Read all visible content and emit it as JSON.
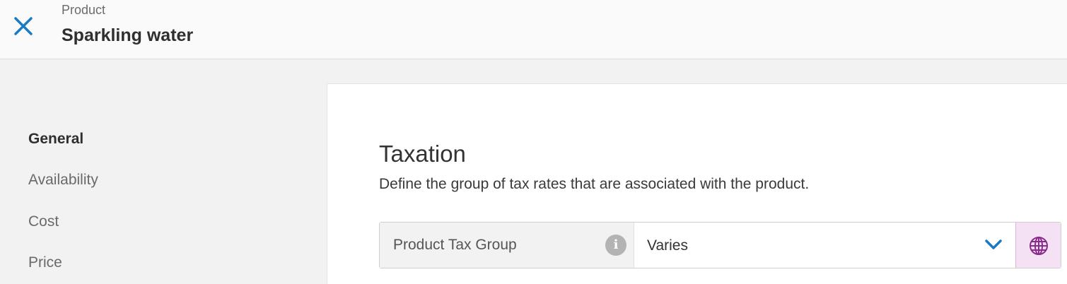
{
  "header": {
    "breadcrumb": "Product",
    "title": "Sparkling water",
    "close_icon": "close-icon"
  },
  "sidebar": {
    "items": [
      {
        "label": "General",
        "active": true
      },
      {
        "label": "Availability",
        "active": false
      },
      {
        "label": "Cost",
        "active": false
      },
      {
        "label": "Price",
        "active": false
      }
    ]
  },
  "main": {
    "section_title": "Taxation",
    "section_description": "Define the group of tax rates that are associated with the product.",
    "tax_group_field": {
      "label": "Product Tax Group",
      "info_icon": "info-icon",
      "value": "Varies",
      "dropdown_icon": "chevron-down-icon",
      "localize_icon": "globe-icon"
    }
  },
  "colors": {
    "accent": "#1a7ac4",
    "globe": "#8a2a8a",
    "globe_bg": "#f4e1f4"
  }
}
